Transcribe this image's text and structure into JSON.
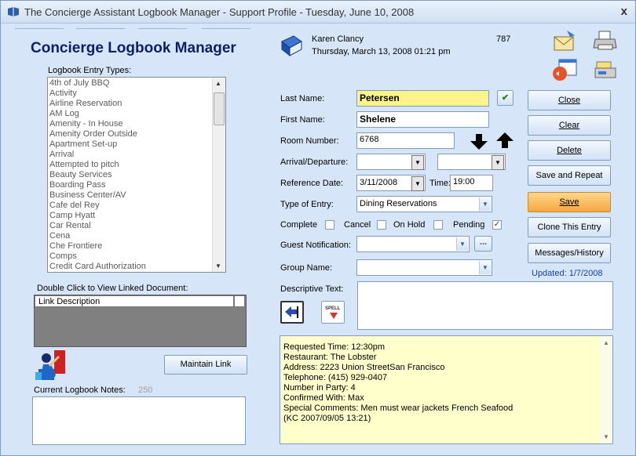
{
  "window": {
    "title": "The Concierge Assistant Logbook Manager - Support Profile - Tuesday, June 10, 2008",
    "close": "x"
  },
  "app_title": "Concierge Logbook Manager",
  "entry_types": {
    "label": "Logbook Entry Types:",
    "items": [
      "4th of July BBQ",
      "Activity",
      "Airline Reservation",
      "AM Log",
      "Amenity - In House",
      "Amenity Order Outside",
      "Apartment Set-up",
      "Arrival",
      "Attempted to pitch",
      "Beauty Services",
      "Boarding Pass",
      "Business Center/AV",
      "Cafe del Rey",
      "Camp Hyatt",
      "Car Rental",
      "Cena",
      "Che Frontiere",
      "Comps",
      "Credit Card Authorization"
    ]
  },
  "linked_docs": {
    "label": "Double Click to View Linked Document:",
    "column": "Link Description"
  },
  "maintain_link": "Maintain Link",
  "notes": {
    "label": "Current Logbook Notes:",
    "count": "250"
  },
  "user": {
    "name": "Karen Clancy",
    "datetime": "Thursday,  March 13, 2008   01:21 pm",
    "record_id": "787"
  },
  "form": {
    "last_name_label": "Last Name:",
    "last_name": "Petersen",
    "first_name_label": "First Name:",
    "first_name": "Shelene",
    "room_label": "Room Number:",
    "room": "6768",
    "arrival_label": "Arrival/Departure:",
    "arrival": "",
    "departure": "",
    "ref_date_label": "Reference Date:",
    "ref_date": "3/11/2008",
    "time_label": "Time:",
    "time": "19:00",
    "type_label": "Type of Entry:",
    "type": "Dining Reservations",
    "complete_label": "Complete",
    "cancel_label": "Cancel",
    "onhold_label": "On Hold",
    "pending_label": "Pending",
    "pending_checked": "✓",
    "guest_notif_label": "Guest Notification:",
    "guest_notif": "",
    "ellipsis": "...",
    "group_label": "Group Name:",
    "group": "",
    "desc_label": "Descriptive Text:",
    "spell": "SPELL"
  },
  "buttons": {
    "close": "Close",
    "clear": "Clear",
    "delete": "Delete",
    "save_repeat": "Save and Repeat",
    "save": "Save",
    "clone": "Clone This Entry",
    "messages": "Messages/History"
  },
  "updated": "Updated: 1/7/2008",
  "details_lines": [
    "Requested Time: 12:30pm",
    "Restaurant: The Lobster",
    "Address: 2223 Union StreetSan Francisco",
    "Telephone: (415) 929-0407",
    "Number in Party: 4",
    "Confirmed With: Max",
    "Special Comments: Men must wear jackets French Seafood",
    " (KC 2007/09/05 13:21)"
  ],
  "colors": {
    "accent_title": "#0f1f66",
    "highlight_field": "#fff38a",
    "notes_bg": "#ffffcc",
    "save_button": "#f7a640",
    "updated_text": "#1a3f9c"
  }
}
